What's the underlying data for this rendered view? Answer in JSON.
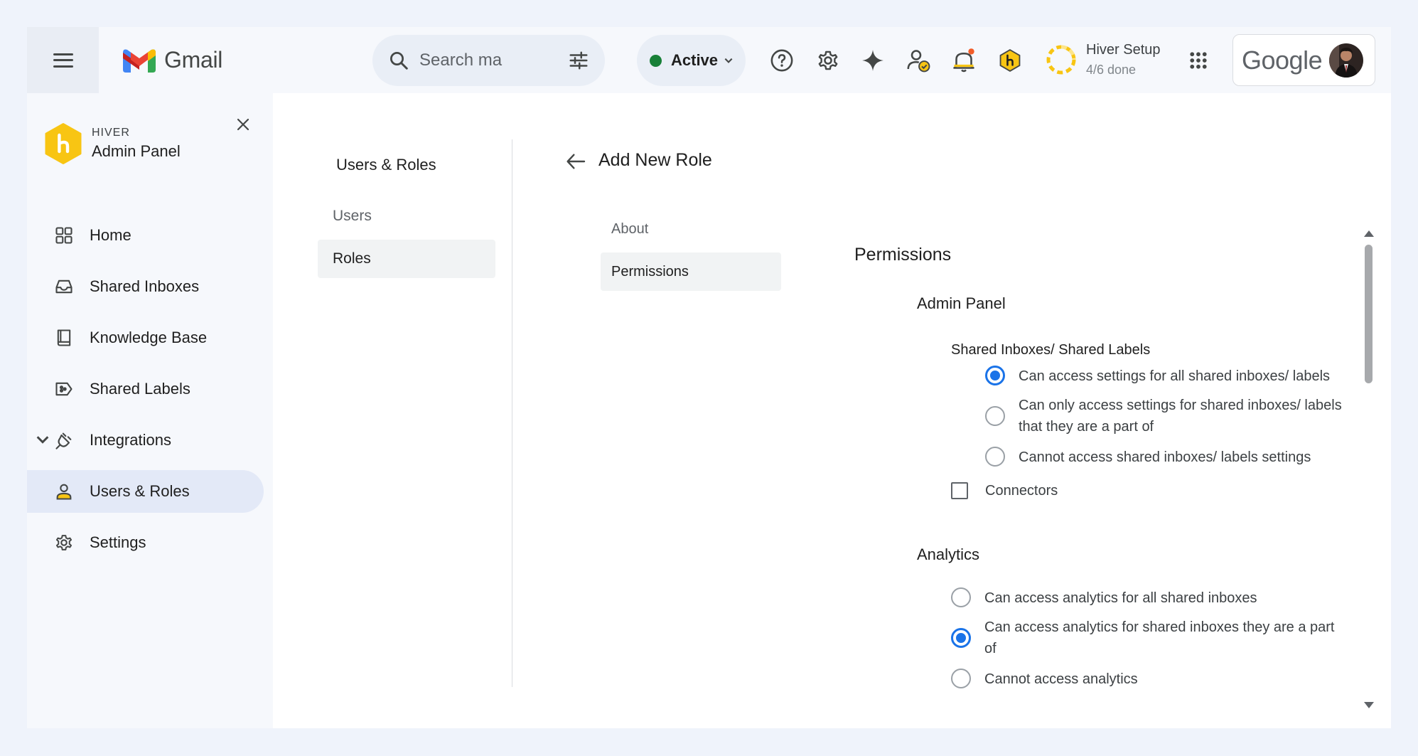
{
  "topbar": {
    "app_name": "Gmail",
    "search_placeholder": "Search ma",
    "status": "Active",
    "setup_title": "Hiver Setup",
    "setup_progress": "4/6 done",
    "account_brand": "Google"
  },
  "sidebar": {
    "brand_small": "HIVER",
    "brand_title": "Admin Panel",
    "items": [
      {
        "label": "Home",
        "icon": "grid-icon"
      },
      {
        "label": "Shared Inboxes",
        "icon": "inbox-icon"
      },
      {
        "label": "Knowledge Base",
        "icon": "book-icon"
      },
      {
        "label": "Shared Labels",
        "icon": "label-share-icon"
      },
      {
        "label": "Integrations",
        "icon": "plug-icon"
      },
      {
        "label": "Users & Roles",
        "icon": "person-icon",
        "active": true
      },
      {
        "label": "Settings",
        "icon": "gear-icon"
      }
    ]
  },
  "main": {
    "section_title": "Users & Roles",
    "section_tabs": [
      "Users",
      "Roles"
    ],
    "page_title": "Add New Role",
    "role_tabs": [
      "About",
      "Permissions"
    ],
    "permissions": {
      "title": "Permissions",
      "admin_panel": {
        "title": "Admin Panel",
        "shared_inboxes_title": "Shared Inboxes/ Shared Labels",
        "options": [
          {
            "label": "Can access settings for all shared inboxes/ labels",
            "selected": true
          },
          {
            "label_line1": "Can only access settings for shared inboxes/ labels",
            "label_line2": "that they are a part of",
            "selected": false
          },
          {
            "label": "Cannot access shared inboxes/ labels settings",
            "selected": false
          }
        ],
        "connectors_label": "Connectors",
        "connectors_checked": false
      },
      "analytics": {
        "title": "Analytics",
        "options": [
          {
            "label": "Can access analytics for all shared inboxes",
            "selected": false
          },
          {
            "label_line1": "Can access analytics for shared inboxes they are a part",
            "label_line2": "of",
            "selected": true
          },
          {
            "label": "Cannot access analytics",
            "selected": false
          }
        ]
      }
    }
  },
  "colors": {
    "accent": "#1a73e8",
    "status_green": "#188038",
    "hiver_yellow": "#f8c513",
    "active_nav_bg": "#e3e9f7"
  }
}
